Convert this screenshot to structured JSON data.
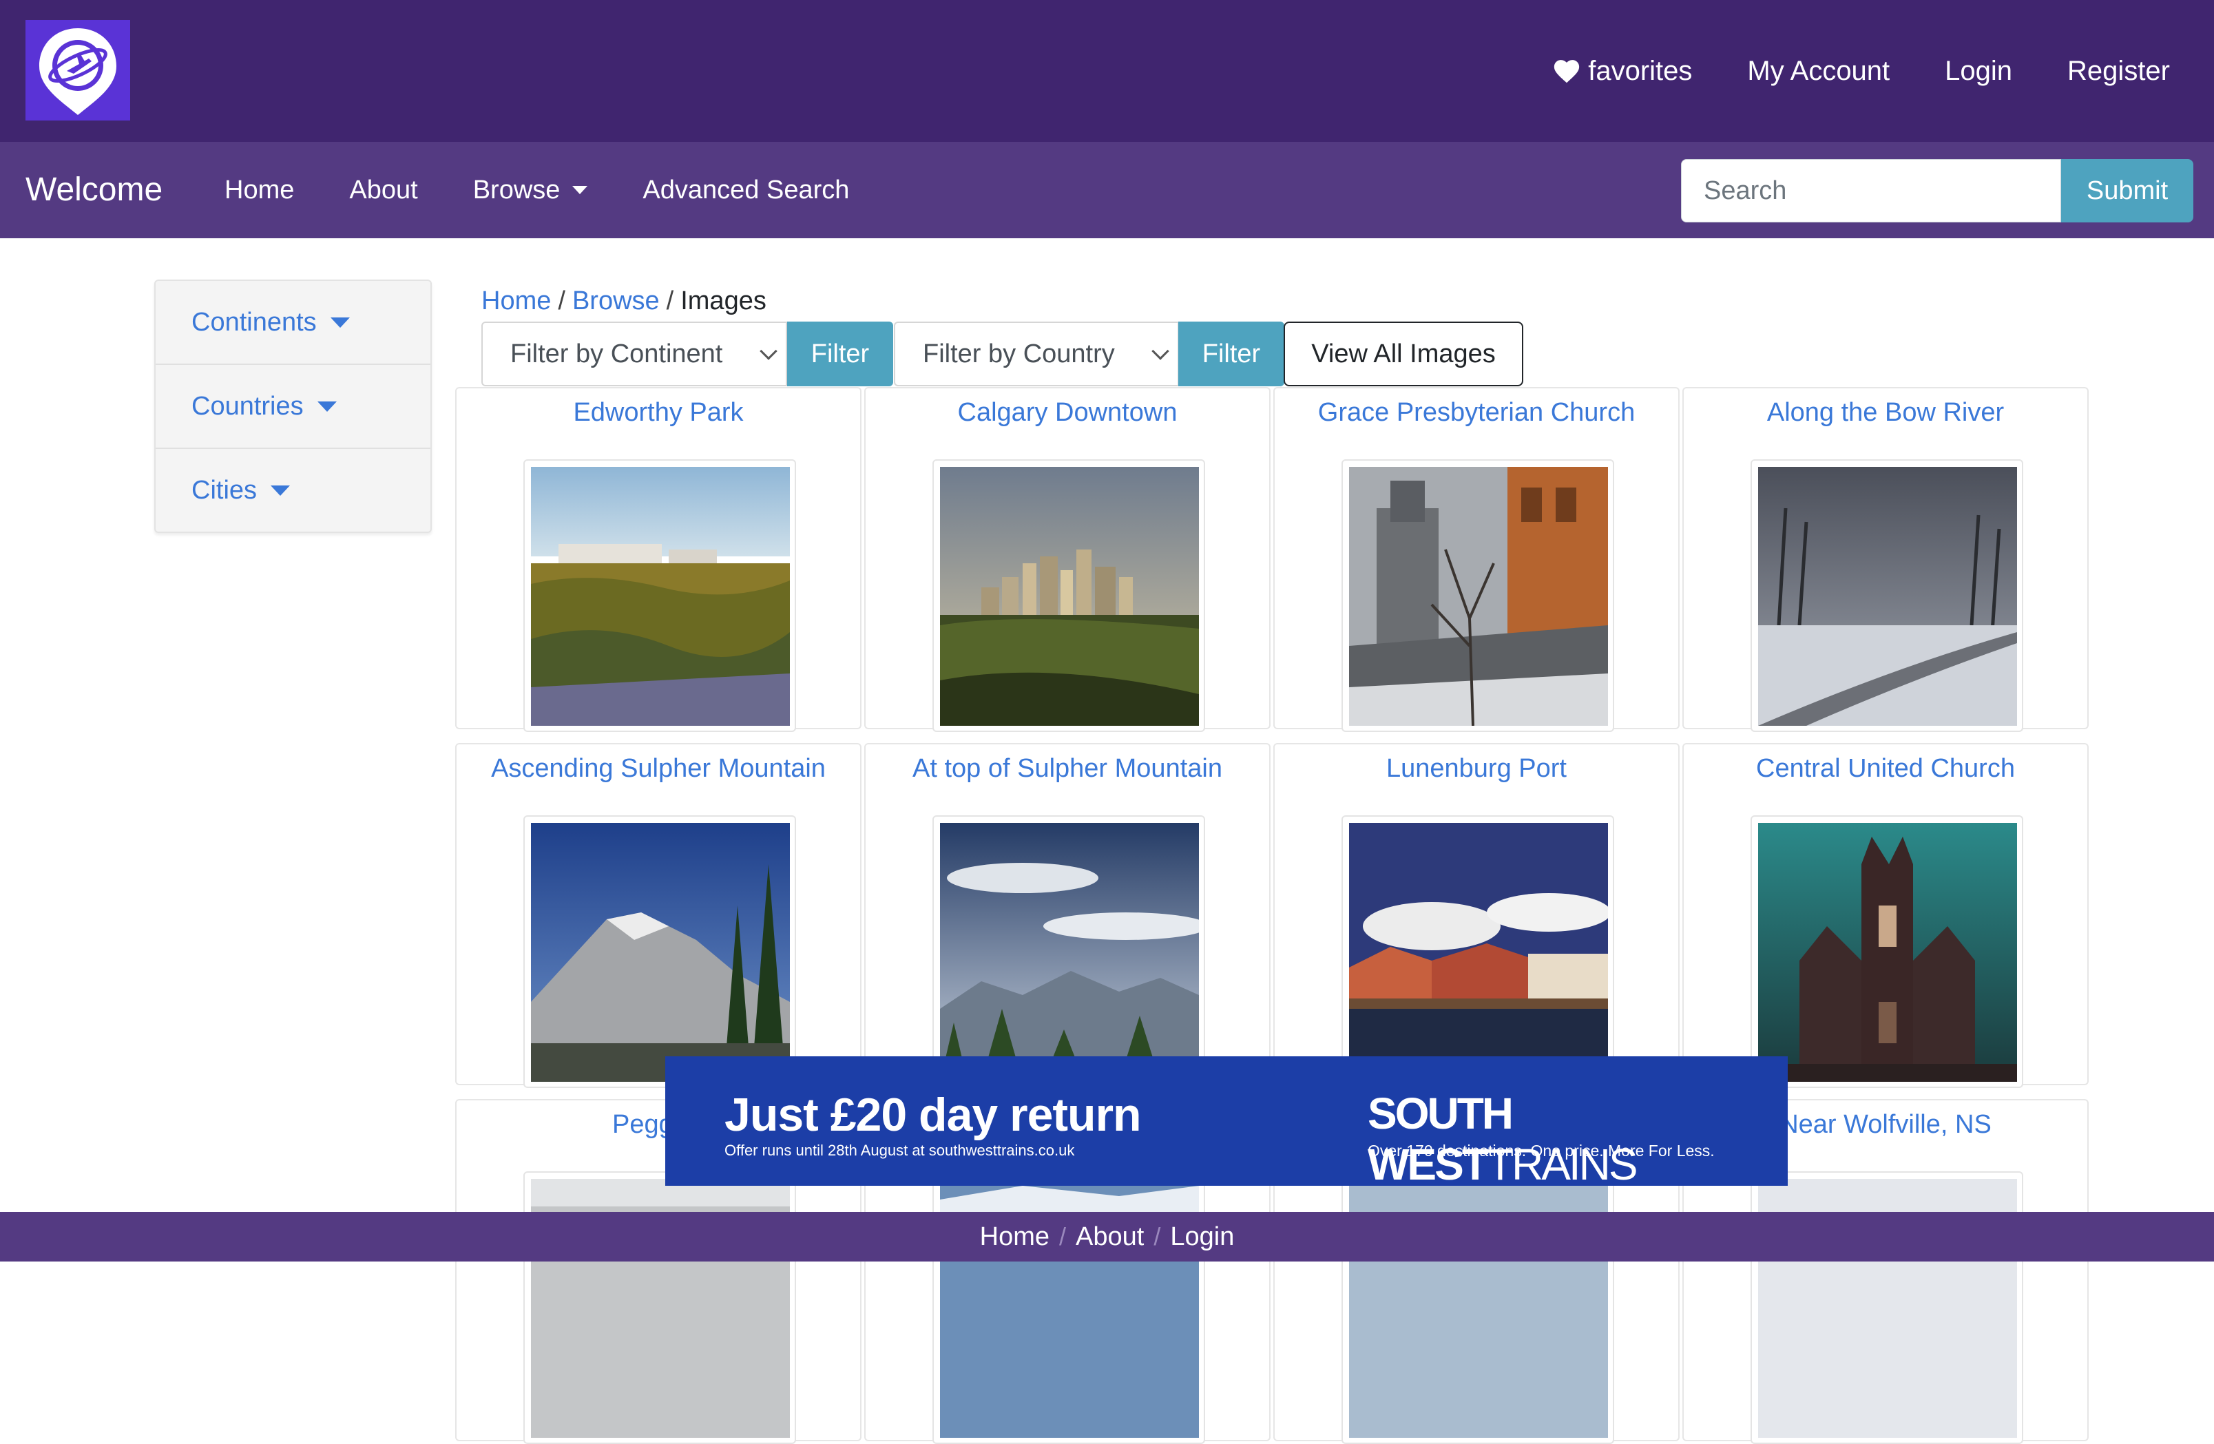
{
  "colors": {
    "topbar": "#40256f",
    "navbar": "#543a82",
    "link": "#3a78d8",
    "accent_button": "#4ea3bf",
    "ad_background": "#1c3ea7"
  },
  "header": {
    "logo_icon": "map-pin-plane-logo",
    "links": [
      {
        "label": "favorites",
        "icon": "heart-icon"
      },
      {
        "label": "My Account"
      },
      {
        "label": "Login"
      },
      {
        "label": "Register"
      }
    ]
  },
  "nav": {
    "brand": "Welcome",
    "items": [
      {
        "label": "Home"
      },
      {
        "label": "About"
      },
      {
        "label": "Browse",
        "has_dropdown": true
      },
      {
        "label": "Advanced Search"
      }
    ],
    "search": {
      "placeholder": "Search",
      "value": ""
    },
    "submit_label": "Submit"
  },
  "sidebar": {
    "items": [
      {
        "label": "Continents"
      },
      {
        "label": "Countries"
      },
      {
        "label": "Cities"
      }
    ]
  },
  "breadcrumb": {
    "items": [
      "Home",
      "Browse"
    ],
    "separator": "/",
    "current": "Images"
  },
  "filters": {
    "continent_select": "Filter by Continent",
    "country_select": "Filter by Country",
    "filter_label": "Filter",
    "view_all_label": "View All Images"
  },
  "images": [
    {
      "title": "Edworthy Park"
    },
    {
      "title": "Calgary Downtown"
    },
    {
      "title": "Grace Presbyterian Church"
    },
    {
      "title": "Along the Bow River"
    },
    {
      "title": "Ascending Sulpher Mountain"
    },
    {
      "title": "At top of Sulpher Mountain"
    },
    {
      "title": "Lunenburg Port"
    },
    {
      "title": "Central United Church"
    },
    {
      "title": "Peggy's"
    },
    {
      "title": ""
    },
    {
      "title": ""
    },
    {
      "title": "Near Wolfville, NS"
    }
  ],
  "ad": {
    "headline": "Just £20 day return",
    "subline": "Offer runs until 28th August at southwesttrains.co.uk",
    "brand_bold": "SOUTH WEST",
    "brand_light": "TRAINS",
    "tagline": "Over 170 destinations. One price. More For Less."
  },
  "footer": {
    "links": [
      "Home",
      "About",
      "Login"
    ],
    "separator": "/"
  }
}
